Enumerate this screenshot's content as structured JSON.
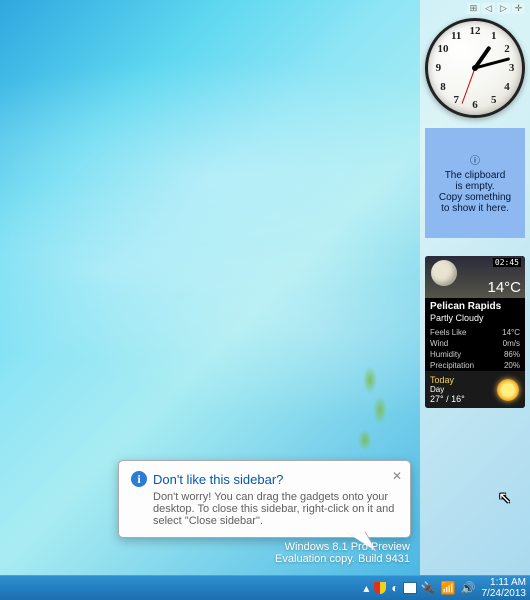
{
  "sidebar": {
    "controls": {
      "gadgets": "⊞",
      "prev": "◁",
      "next": "▷",
      "add": "✛"
    }
  },
  "clock": {
    "numerals": {
      "n12": "12",
      "n1": "1",
      "n2": "2",
      "n3": "3",
      "n4": "4",
      "n5": "5",
      "n6": "6",
      "n7": "7",
      "n8": "8",
      "n9": "9",
      "n10": "10",
      "n11": "11"
    }
  },
  "clipboard": {
    "line1": "The clipboard",
    "line2": "is empty.",
    "line3": "Copy something",
    "line4": "to show it here."
  },
  "weather": {
    "obs_time": "02:45",
    "temp": "14°C",
    "location": "Pelican Rapids",
    "condition": "Partly Cloudy",
    "feels_like_label": "Feels Like",
    "feels_like": "14°C",
    "wind_label": "Wind",
    "wind": "0m/s",
    "humidity_label": "Humidity",
    "humidity": "86%",
    "precip_label": "Precipitation",
    "precip": "20%",
    "today_label": "Today",
    "today_period": "Day",
    "today_hilo": "27° / 16°"
  },
  "balloon": {
    "title": "Don't like this sidebar?",
    "body": "Don't worry! You can drag the gadgets onto your desktop. To close this sidebar, right-click on it and select \"Close sidebar\"."
  },
  "build": {
    "line1": "Windows 8.1 Pro Preview",
    "line2": "Evaluation copy. Build 9431"
  },
  "taskbar": {
    "time": "1:11 AM",
    "date": "7/24/2013"
  }
}
